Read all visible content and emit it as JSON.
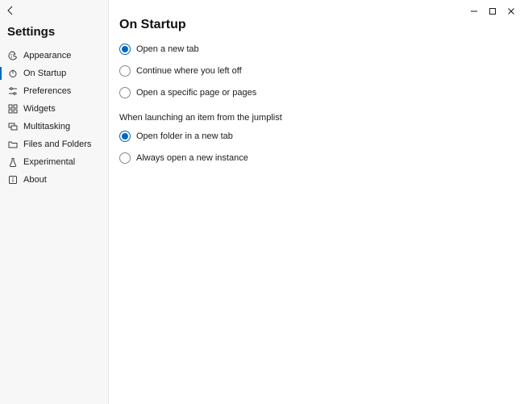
{
  "window": {
    "minimize": "–",
    "maximize": "▢",
    "close": "✕"
  },
  "sidebar": {
    "title": "Settings",
    "items": [
      {
        "label": "Appearance"
      },
      {
        "label": "On Startup"
      },
      {
        "label": "Preferences"
      },
      {
        "label": "Widgets"
      },
      {
        "label": "Multitasking"
      },
      {
        "label": "Files and Folders"
      },
      {
        "label": "Experimental"
      },
      {
        "label": "About"
      }
    ]
  },
  "page": {
    "title": "On Startup",
    "group1": {
      "options": [
        {
          "label": "Open a new tab",
          "checked": true
        },
        {
          "label": "Continue where you left off",
          "checked": false
        },
        {
          "label": "Open a specific page or pages",
          "checked": false
        }
      ]
    },
    "jumplist_heading": "When launching an item from the jumplist",
    "group2": {
      "options": [
        {
          "label": "Open folder in a new tab",
          "checked": true
        },
        {
          "label": "Always open a new instance",
          "checked": false
        }
      ]
    }
  }
}
